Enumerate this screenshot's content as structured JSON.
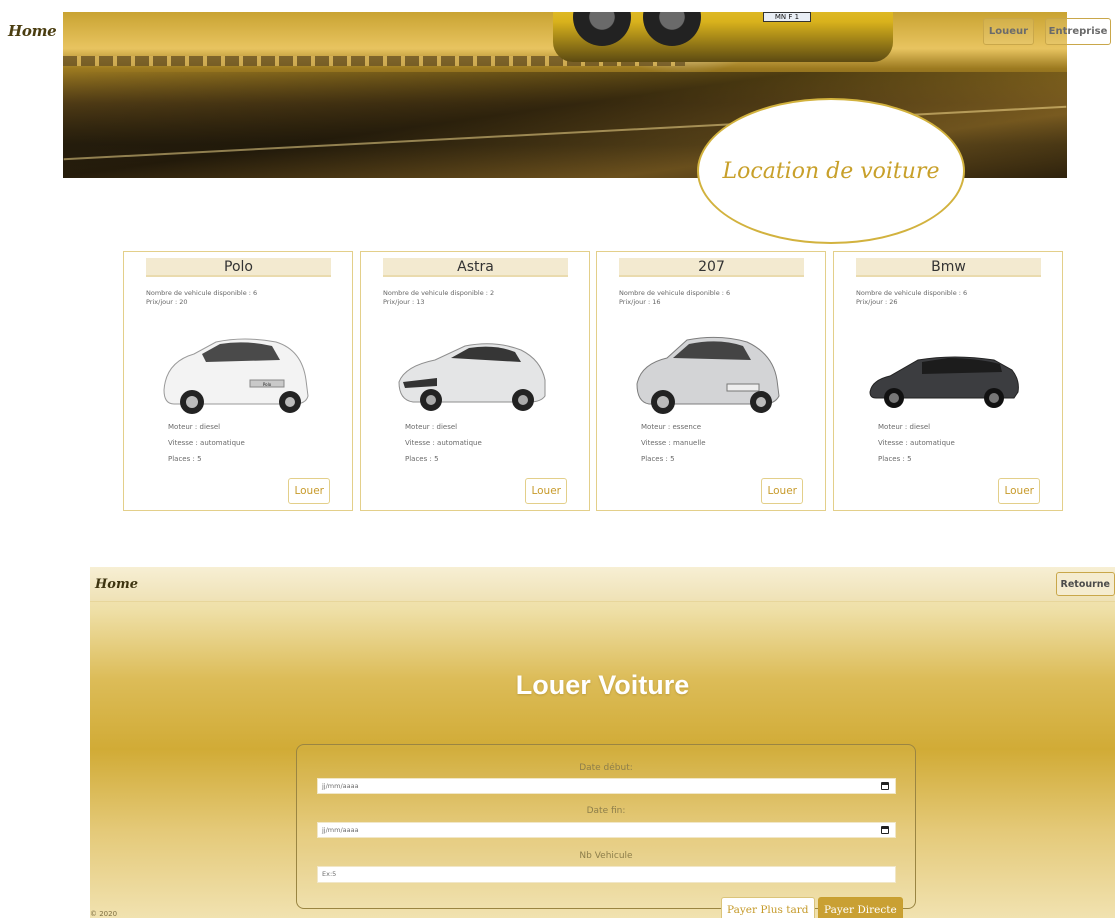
{
  "top_nav": {
    "home": "Home",
    "buttons": [
      "Loueur",
      "Entreprise"
    ]
  },
  "hero": {
    "plate": "MN F 1",
    "title": "Location de voiture"
  },
  "cars": [
    {
      "name": "Polo",
      "dispo": "Nombre de vehicule disponible : 6",
      "prix": "Prix/jour : 20",
      "moteur": "Moteur : diesel",
      "vitesse": "Vitesse : automatique",
      "places": "Places : 5",
      "button": "Louer"
    },
    {
      "name": "Astra",
      "dispo": "Nombre de vehicule disponible : 2",
      "prix": "Prix/jour : 13",
      "moteur": "Moteur : diesel",
      "vitesse": "Vitesse : automatique",
      "places": "Places : 5",
      "button": "Louer"
    },
    {
      "name": "207",
      "dispo": "Nombre de vehicule disponible : 6",
      "prix": "Prix/jour : 16",
      "moteur": "Moteur : essence",
      "vitesse": "Vitesse : manuelle",
      "places": "Places : 5",
      "button": "Louer"
    },
    {
      "name": "Bmw",
      "dispo": "Nombre de vehicule disponible : 6",
      "prix": "Prix/jour : 26",
      "moteur": "Moteur : diesel",
      "vitesse": "Vitesse : automatique",
      "places": "Places : 5",
      "button": "Louer"
    }
  ],
  "car_colors": [
    "#f2f2f2",
    "#e6e7e8",
    "#d9d9d9",
    "#3a3b3e"
  ],
  "form_page": {
    "home": "Home",
    "retour": "Retourne",
    "title": "Louer Voiture",
    "date_debut_label": "Date début:",
    "date_debut_placeholder": "jj/mm/aaaa",
    "date_fin_label": "Date fin:",
    "date_fin_placeholder": "jj/mm/aaaa",
    "nb_label": "Nb Vehicule",
    "nb_placeholder": "Ex:5",
    "btn_later": "Payer Plus tard",
    "btn_direct": "Payer Directe",
    "copyright": "© 2020"
  },
  "colors": {
    "accent": "#c9a033",
    "card_border": "#e3cf8a",
    "title_bg": "#f3ead0"
  }
}
